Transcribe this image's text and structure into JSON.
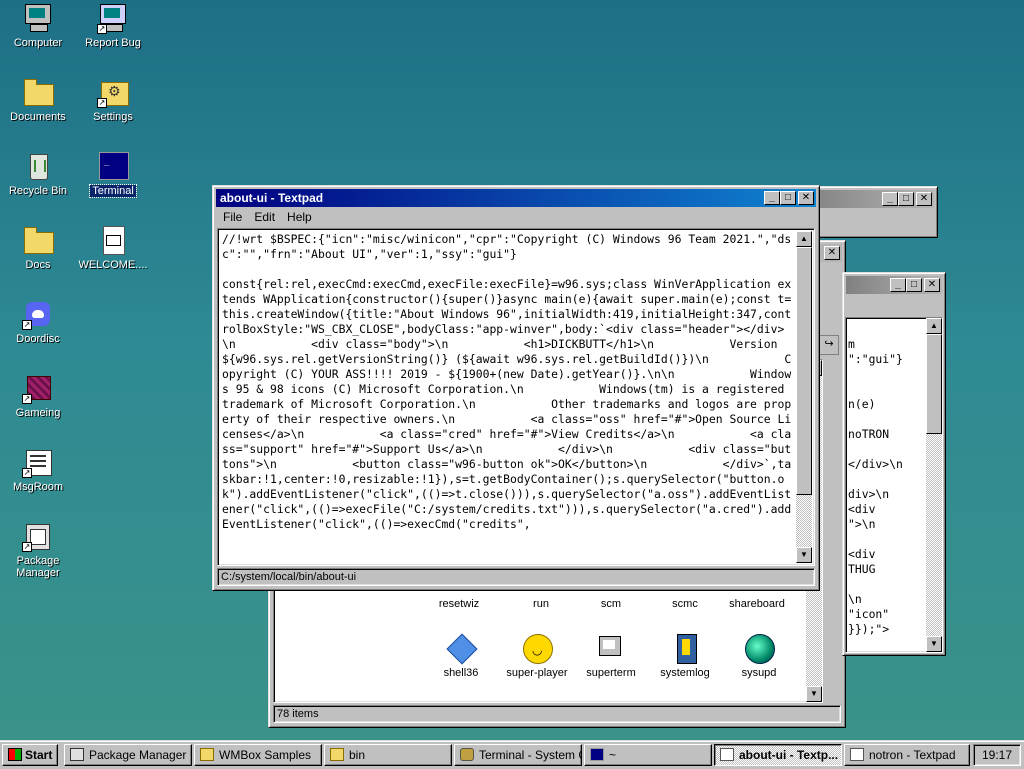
{
  "desktop": {
    "icons": [
      {
        "label": "Computer"
      },
      {
        "label": "Report Bug"
      },
      {
        "label": "Documents"
      },
      {
        "label": "Settings"
      },
      {
        "label": "Recycle Bin"
      },
      {
        "label": "Terminal"
      },
      {
        "label": "Docs"
      },
      {
        "label": "WELCOME...."
      },
      {
        "label": "Doordisc"
      },
      {
        "label": "Gameing"
      },
      {
        "label": "MsgRoom"
      },
      {
        "label": "Package Manager"
      }
    ]
  },
  "textpad": {
    "title": "about-ui - Textpad",
    "menu": [
      "File",
      "Edit",
      "Help"
    ],
    "content": "//!wrt $BSPEC:{\"icn\":\"misc/winicon\",\"cpr\":\"Copyright (C) Windows 96 Team 2021.\",\"dsc\":\"\",\"frn\":\"About UI\",\"ver\":1,\"ssy\":\"gui\"}\n\nconst{rel:rel,execCmd:execCmd,execFile:execFile}=w96.sys;class WinVerApplication extends WApplication{constructor(){super()}async main(e){await super.main(e);const t=this.createWindow({title:\"About Windows 96\",initialWidth:419,initialHeight:347,controlBoxStyle:\"WS_CBX_CLOSE\",bodyClass:\"app-winver\",body:`<div class=\"header\"></div>\\n           <div class=\"body\">\\n           <h1>DICKBUTT</h1>\\n           Version ${w96.sys.rel.getVersionString()} (${await w96.sys.rel.getBuildId()})\\n           Copyright (C) YOUR ASS!!!! 2019 - ${1900+(new Date).getYear()}.\\n\\n           Windows 95 & 98 icons (C) Microsoft Corporation.\\n           Windows(tm) is a registered trademark of Microsoft Corporation.\\n           Other trademarks and logos are property of their respective owners.\\n           <a class=\"oss\" href=\"#\">Open Source Licenses</a>\\n           <a class=\"cred\" href=\"#\">View Credits</a>\\n           <a class=\"support\" href=\"#\">Support Us</a>\\n           </div>\\n           <div class=\"buttons\">\\n           <button class=\"w96-button ok\">OK</button>\\n           </div>`,taskbar:!1,center:!0,resizable:!1}),s=t.getBodyContainer();s.querySelector(\"button.ok\").addEventListener(\"click\",(()=>t.close())),s.querySelector(\"a.oss\").addEventListener(\"click\",(()=>execFile(\"C:/system/credits.txt\"))),s.querySelector(\"a.cred\").addEventListener(\"click\",(()=>execCmd(\"credits\",",
    "status": "C:/system/local/bin/about-ui"
  },
  "notron": {
    "visible_fragments": [
      "m",
      "\":\"gui\"}",
      "n(e)",
      "noTRON",
      "</div>\\n",
      "div>\\n",
      "<div",
      "\">\\n",
      "<div",
      "THUG",
      "\\n",
      "\"icon\"",
      "}});\">"
    ]
  },
  "explorer": {
    "items_row1": [
      {
        "label": "resetwiz"
      },
      {
        "label": "run"
      },
      {
        "label": "scm"
      },
      {
        "label": "scmc"
      },
      {
        "label": "shareboard"
      }
    ],
    "items_row2": [
      {
        "label": "shell36",
        "icon": "diamond-icon"
      },
      {
        "label": "super-player",
        "icon": "smiley-icon"
      },
      {
        "label": "superterm",
        "icon": "computer-icon"
      },
      {
        "label": "systemlog",
        "icon": "book-icon"
      },
      {
        "label": "sysupd",
        "icon": "globe-icon"
      }
    ],
    "status": "78 items"
  },
  "taskbar": {
    "start": "Start",
    "items": [
      {
        "label": "Package Manager"
      },
      {
        "label": "WMBox Samples"
      },
      {
        "label": "bin"
      },
      {
        "label": "Terminal - System C..."
      },
      {
        "label": "~"
      },
      {
        "label": "about-ui - Textp..."
      },
      {
        "label": "notron - Textpad"
      }
    ],
    "clock": "19:17"
  },
  "window_buttons": {
    "minimize": "_",
    "maximize": "□",
    "close": "✕",
    "arrow_up": "▲",
    "arrow_down": "▼"
  }
}
